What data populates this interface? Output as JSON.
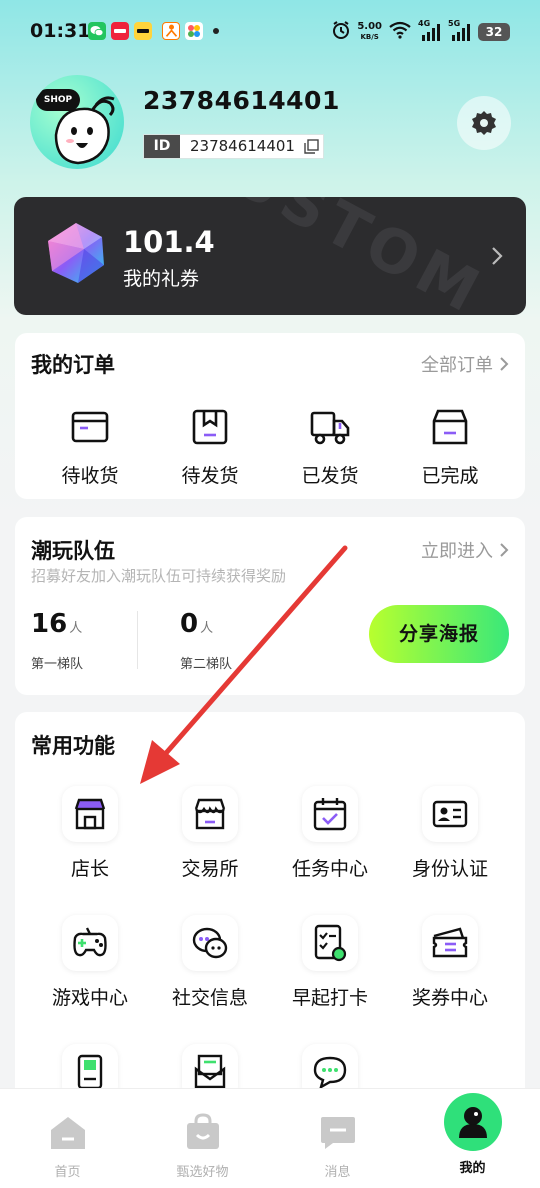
{
  "status_bar": {
    "time": "01:31",
    "net_speed": "5.00",
    "net_unit": "KB/S",
    "signal_1": "4G",
    "signal_2": "5G",
    "battery": "32",
    "app_icons": [
      "wechat-icon",
      "xiaohongshu-icon",
      "meituan-icon",
      "taobao-icon",
      "photos-icon"
    ]
  },
  "profile": {
    "avatar_text": "SHOP",
    "username": "23784614401",
    "id_label": "ID",
    "id_value": "23784614401"
  },
  "coupon": {
    "amount": "101.4",
    "label": "我的礼券",
    "watermark": "CUSTOM"
  },
  "orders": {
    "title": "我的订单",
    "link": "全部订单",
    "items": [
      {
        "label": "待收货",
        "icon": "wallet-icon"
      },
      {
        "label": "待发货",
        "icon": "package-icon"
      },
      {
        "label": "已发货",
        "icon": "truck-icon"
      },
      {
        "label": "已完成",
        "icon": "box-check-icon"
      }
    ]
  },
  "team": {
    "title": "潮玩队伍",
    "link": "立即进入",
    "subtitle": "招募好友加入潮玩队伍可持续获得奖励",
    "first_count": "16",
    "first_unit": "人",
    "first_label": "第一梯队",
    "second_count": "0",
    "second_unit": "人",
    "second_label": "第二梯队",
    "share_button": "分享海报"
  },
  "functions": {
    "title": "常用功能",
    "items": [
      {
        "label": "店长",
        "icon": "store-owner-icon"
      },
      {
        "label": "交易所",
        "icon": "exchange-store-icon"
      },
      {
        "label": "任务中心",
        "icon": "calendar-check-icon"
      },
      {
        "label": "身份认证",
        "icon": "id-card-icon"
      },
      {
        "label": "游戏中心",
        "icon": "gamepad-icon"
      },
      {
        "label": "社交信息",
        "icon": "chat-bubbles-icon"
      },
      {
        "label": "早起打卡",
        "icon": "checklist-icon"
      },
      {
        "label": "奖券中心",
        "icon": "ticket-icon"
      }
    ]
  },
  "bottom_nav": {
    "items": [
      {
        "label": "首页",
        "icon": "home-icon"
      },
      {
        "label": "甄选好物",
        "icon": "shopping-bag-icon"
      },
      {
        "label": "消息",
        "icon": "message-icon"
      },
      {
        "label": "我的",
        "icon": "profile-icon"
      }
    ]
  },
  "colors": {
    "accent_green": "#2fe07a",
    "purple_accent": "#8b5cf6",
    "card_dark": "#2c2c2e",
    "arrow_red": "#e53935"
  }
}
